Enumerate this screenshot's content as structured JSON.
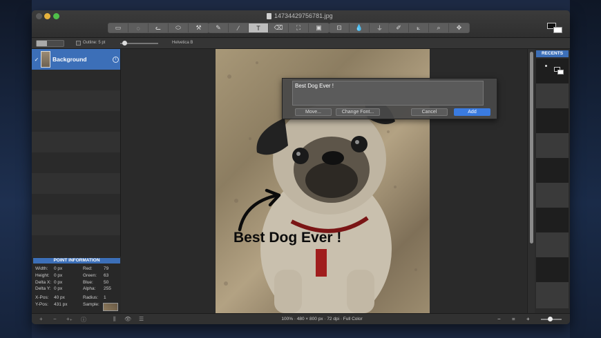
{
  "window": {
    "title": "14734429756781.jpg"
  },
  "toolbar": {
    "group1": [
      "▭",
      "◌",
      "ᓚ",
      "⬭",
      "⚒"
    ],
    "group2": [
      "✎",
      "⁄",
      "T",
      "⌫",
      "⛶",
      "▣"
    ],
    "group3": [
      "⊡",
      "💧",
      "⏚"
    ],
    "group4": [
      "✐",
      "⟀",
      "⌕",
      "✥"
    ],
    "active_tool": "T"
  },
  "options": {
    "outline_label": "Outline: 5 pt",
    "font_label": "Helvetica B"
  },
  "layers": [
    {
      "name": "Background",
      "selected": true
    }
  ],
  "text_dialog": {
    "value": "Best Dog Ever !",
    "move_label": "Move...",
    "change_font_label": "Change Font...",
    "cancel_label": "Cancel",
    "add_label": "Add"
  },
  "photo_text": "Best Dog Ever !",
  "point_info": {
    "title": "POINT INFORMATION",
    "width": "Width:",
    "width_val": "0 px",
    "height": "Height:",
    "height_val": "0 px",
    "delta_x": "Delta X:",
    "delta_x_val": "0 px",
    "delta_y": "Delta Y:",
    "delta_y_val": "0 px",
    "x_pos": "X-Pos:",
    "x_pos_val": "40 px",
    "y_pos": "Y-Pos:",
    "y_pos_val": "431 px",
    "red": "Red:",
    "red_val": "79",
    "green": "Green:",
    "green_val": "63",
    "blue": "Blue:",
    "blue_val": "50",
    "alpha": "Alpha:",
    "alpha_val": "255",
    "radius": "Radius:",
    "radius_val": "1",
    "sample": "Sample:"
  },
  "recents": {
    "title": "RECENTS"
  },
  "status": {
    "info": "100% · 480 × 800 px · 72 dpi · Full Color",
    "icons": [
      "+",
      "−",
      "+₊",
      "ⓘ",
      "⫼",
      "👁",
      "☰"
    ],
    "zoom_minus": "−",
    "zoom_equal": "=",
    "zoom_plus": "+"
  }
}
